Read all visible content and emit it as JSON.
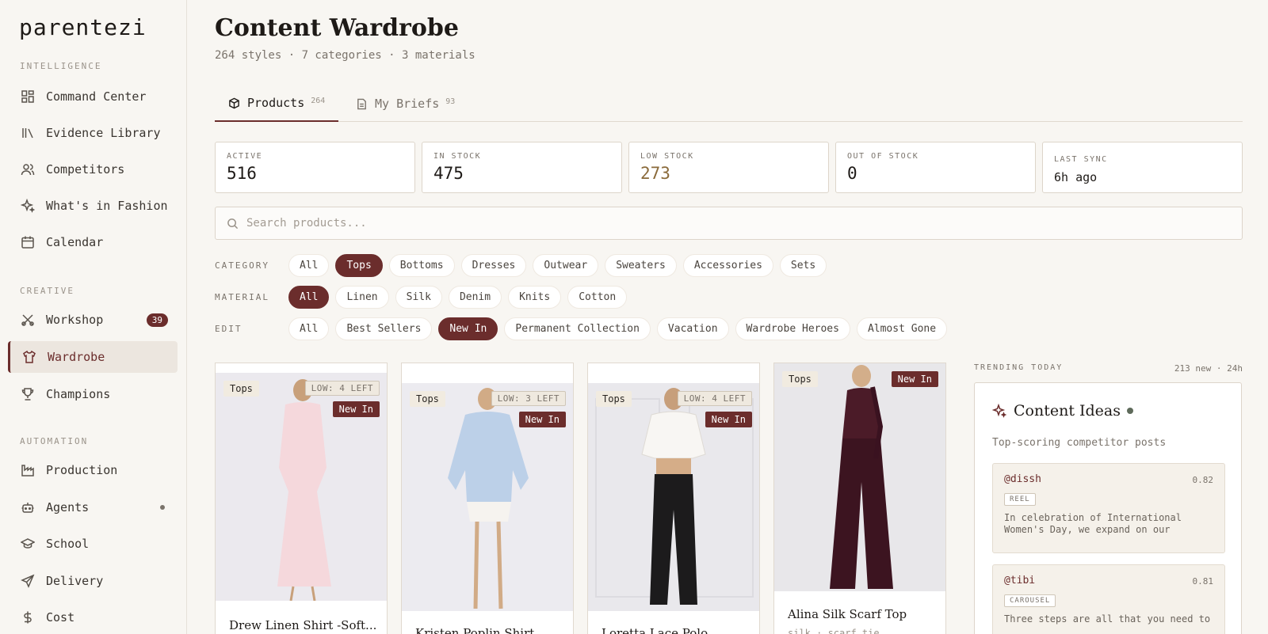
{
  "app": {
    "logo": "parentezi"
  },
  "sidebar": {
    "sections": {
      "intelligence": "INTELLIGENCE",
      "creative": "CREATIVE",
      "automation": "AUTOMATION"
    },
    "items": [
      {
        "label": "Command Center",
        "icon": "grid-icon"
      },
      {
        "label": "Evidence Library",
        "icon": "library-icon"
      },
      {
        "label": "Competitors",
        "icon": "users-icon"
      },
      {
        "label": "What's in Fashion",
        "icon": "sparkle-icon"
      },
      {
        "label": "Calendar",
        "icon": "calendar-icon"
      },
      {
        "label": "Workshop",
        "icon": "scissors-icon",
        "badge": "39"
      },
      {
        "label": "Wardrobe",
        "icon": "shirt-icon",
        "active": true
      },
      {
        "label": "Champions",
        "icon": "trophy-icon"
      },
      {
        "label": "Production",
        "icon": "factory-icon"
      },
      {
        "label": "Agents",
        "icon": "bot-icon"
      },
      {
        "label": "School",
        "icon": "graduation-cap-icon"
      },
      {
        "label": "Delivery",
        "icon": "send-icon"
      },
      {
        "label": "Cost",
        "icon": "dollar-icon"
      }
    ]
  },
  "page": {
    "title": "Content Wardrobe",
    "subtitle": "264 styles · 7 categories · 3 materials"
  },
  "tabs": [
    {
      "label": "Products",
      "count": "264",
      "icon": "box-icon",
      "active": true
    },
    {
      "label": "My Briefs",
      "count": "93",
      "icon": "document-icon"
    }
  ],
  "stats": [
    {
      "label": "ACTIVE",
      "value": "516"
    },
    {
      "label": "IN STOCK",
      "value": "475"
    },
    {
      "label": "LOW STOCK",
      "value": "273"
    },
    {
      "label": "OUT OF STOCK",
      "value": "0"
    },
    {
      "label": "LAST SYNC",
      "value": "6h ago"
    }
  ],
  "search": {
    "placeholder": "Search products..."
  },
  "filters": {
    "category": {
      "label": "CATEGORY",
      "options": [
        "All",
        "Tops",
        "Bottoms",
        "Dresses",
        "Outwear",
        "Sweaters",
        "Accessories",
        "Sets"
      ],
      "selected": "Tops"
    },
    "material": {
      "label": "MATERIAL",
      "options": [
        "All",
        "Linen",
        "Silk",
        "Denim",
        "Knits",
        "Cotton"
      ],
      "selected": "All"
    },
    "edit": {
      "label": "EDIT",
      "options": [
        "All",
        "Best Sellers",
        "New In",
        "Permanent Collection",
        "Vacation",
        "Wardrobe Heroes",
        "Almost Gone"
      ],
      "selected": "New In"
    }
  },
  "products": [
    {
      "category": "Tops",
      "stock": "LOW: 4 LEFT",
      "badge": "New In",
      "name": "Drew Linen Shirt -Soft...",
      "meta": ""
    },
    {
      "category": "Tops",
      "stock": "LOW: 3 LEFT",
      "badge": "New In",
      "name": "Kristen Poplin Shirt",
      "meta": ""
    },
    {
      "category": "Tops",
      "stock": "LOW: 4 LEFT",
      "badge": "New In",
      "name": "Loretta Lace Polo",
      "meta": ""
    },
    {
      "category": "Tops",
      "stock": "",
      "badge": "New In",
      "name": "Alina Silk Scarf Top",
      "meta": "silk · scarf tie"
    }
  ],
  "trending": {
    "label": "TRENDING TODAY",
    "meta": "213 new · 24h",
    "title": "Content Ideas",
    "subtitle": "Top-scoring competitor posts",
    "posts": [
      {
        "handle": "@dissh",
        "score": "0.82",
        "type": "REEL",
        "text": "In celebration of International Women's Day, we expand on our existin…"
      },
      {
        "handle": "@tibi",
        "score": "0.81",
        "type": "CAROUSEL",
        "text": "Three steps are all that you need to"
      }
    ]
  },
  "colors": {
    "accent": "#6b2d2c",
    "background": "#f8f6f2",
    "border": "#ddd5ca"
  }
}
